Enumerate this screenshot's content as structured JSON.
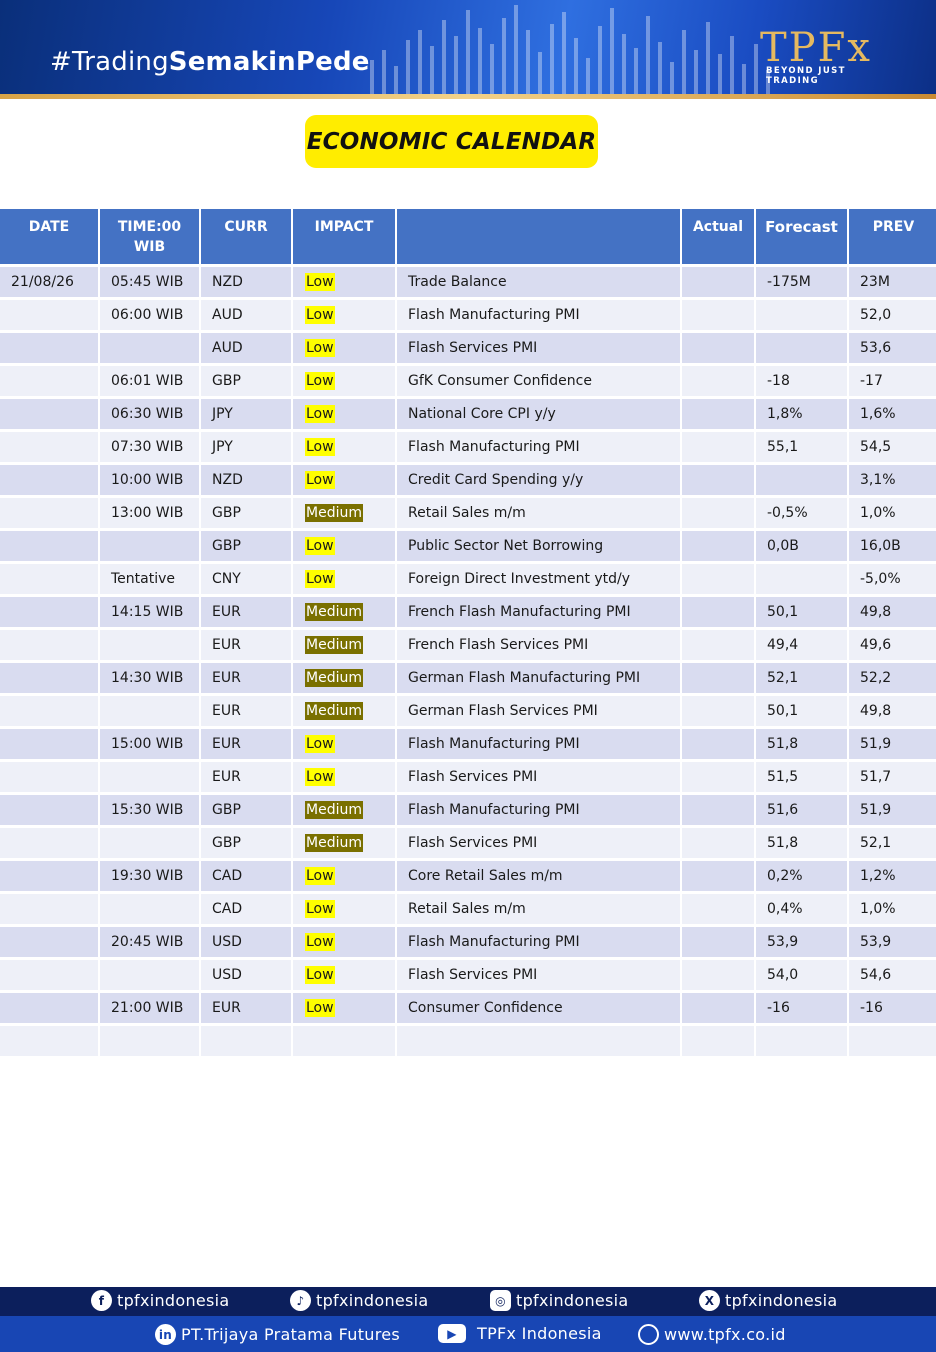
{
  "banner": {
    "hashtag_light": "#Trading",
    "hashtag_bold": "SemakinPede",
    "logo_text": "TPFx",
    "logo_tagline": "BEYOND JUST TRADING"
  },
  "title": "ECONOMIC CALENDAR",
  "table": {
    "headers": {
      "date": "DATE",
      "time_line1": "TIME:00",
      "time_line2": "WIB",
      "curr": "CURR",
      "impact": "IMPACT",
      "event": "",
      "actual": "Actual",
      "forecast": "Forecast",
      "prev": "PREV"
    },
    "rows": [
      {
        "date": "21/08/26",
        "time": "05:45 WIB",
        "curr": "NZD",
        "impact": "Low",
        "event": "Trade Balance",
        "actual": "",
        "forecast": "-175M",
        "prev": "23M"
      },
      {
        "date": "",
        "time": "06:00 WIB",
        "curr": "AUD",
        "impact": "Low",
        "event": "Flash Manufacturing PMI",
        "actual": "",
        "forecast": "",
        "prev": "52,0"
      },
      {
        "date": "",
        "time": "",
        "curr": "AUD",
        "impact": "Low",
        "event": "Flash Services PMI",
        "actual": "",
        "forecast": "",
        "prev": "53,6"
      },
      {
        "date": "",
        "time": "06:01 WIB",
        "curr": "GBP",
        "impact": "Low",
        "event": "GfK Consumer Confidence",
        "actual": "",
        "forecast": "-18",
        "prev": "-17"
      },
      {
        "date": "",
        "time": "06:30 WIB",
        "curr": "JPY",
        "impact": "Low",
        "event": "National Core CPI y/y",
        "actual": "",
        "forecast": "1,8%",
        "prev": "1,6%"
      },
      {
        "date": "",
        "time": "07:30 WIB",
        "curr": "JPY",
        "impact": "Low",
        "event": "Flash Manufacturing PMI",
        "actual": "",
        "forecast": "55,1",
        "prev": "54,5"
      },
      {
        "date": "",
        "time": "10:00 WIB",
        "curr": "NZD",
        "impact": "Low",
        "event": "Credit Card Spending y/y",
        "actual": "",
        "forecast": "",
        "prev": "3,1%"
      },
      {
        "date": "",
        "time": "13:00 WIB",
        "curr": "GBP",
        "impact": "Medium",
        "event": "Retail Sales m/m",
        "actual": "",
        "forecast": "-0,5%",
        "prev": "1,0%"
      },
      {
        "date": "",
        "time": "",
        "curr": "GBP",
        "impact": "Low",
        "event": "Public Sector Net Borrowing",
        "actual": "",
        "forecast": "0,0B",
        "prev": "16,0B"
      },
      {
        "date": "",
        "time": "Tentative",
        "curr": "CNY",
        "impact": "Low",
        "event": "Foreign Direct Investment ytd/y",
        "actual": "",
        "forecast": "",
        "prev": "-5,0%"
      },
      {
        "date": "",
        "time": "14:15 WIB",
        "curr": "EUR",
        "impact": "Medium",
        "event": "French Flash Manufacturing PMI",
        "actual": "",
        "forecast": "50,1",
        "prev": "49,8"
      },
      {
        "date": "",
        "time": "",
        "curr": "EUR",
        "impact": "Medium",
        "event": "French Flash Services PMI",
        "actual": "",
        "forecast": "49,4",
        "prev": "49,6"
      },
      {
        "date": "",
        "time": "14:30 WIB",
        "curr": "EUR",
        "impact": "Medium",
        "event": "German Flash Manufacturing PMI",
        "actual": "",
        "forecast": "52,1",
        "prev": "52,2"
      },
      {
        "date": "",
        "time": "",
        "curr": "EUR",
        "impact": "Medium",
        "event": "German Flash Services PMI",
        "actual": "",
        "forecast": "50,1",
        "prev": "49,8"
      },
      {
        "date": "",
        "time": "15:00 WIB",
        "curr": "EUR",
        "impact": "Low",
        "event": "Flash Manufacturing PMI",
        "actual": "",
        "forecast": "51,8",
        "prev": "51,9"
      },
      {
        "date": "",
        "time": "",
        "curr": "EUR",
        "impact": "Low",
        "event": "Flash Services PMI",
        "actual": "",
        "forecast": "51,5",
        "prev": "51,7"
      },
      {
        "date": "",
        "time": "15:30 WIB",
        "curr": "GBP",
        "impact": "Medium",
        "event": "Flash Manufacturing PMI",
        "actual": "",
        "forecast": "51,6",
        "prev": "51,9"
      },
      {
        "date": "",
        "time": "",
        "curr": "GBP",
        "impact": "Medium",
        "event": "Flash Services PMI",
        "actual": "",
        "forecast": "51,8",
        "prev": "52,1"
      },
      {
        "date": "",
        "time": "19:30 WIB",
        "curr": "CAD",
        "impact": "Low",
        "event": "Core Retail Sales m/m",
        "actual": "",
        "forecast": "0,2%",
        "prev": "1,2%"
      },
      {
        "date": "",
        "time": "",
        "curr": "CAD",
        "impact": "Low",
        "event": "Retail Sales m/m",
        "actual": "",
        "forecast": "0,4%",
        "prev": "1,0%"
      },
      {
        "date": "",
        "time": "20:45 WIB",
        "curr": "USD",
        "impact": "Low",
        "event": "Flash Manufacturing PMI",
        "actual": "",
        "forecast": "53,9",
        "prev": "53,9"
      },
      {
        "date": "",
        "time": "",
        "curr": "USD",
        "impact": "Low",
        "event": "Flash Services PMI",
        "actual": "",
        "forecast": "54,0",
        "prev": "54,6"
      },
      {
        "date": "",
        "time": "21:00 WIB",
        "curr": "EUR",
        "impact": "Low",
        "event": "Consumer Confidence",
        "actual": "",
        "forecast": "-16",
        "prev": "-16"
      },
      {
        "date": "",
        "time": "",
        "curr": "",
        "impact": "",
        "event": "",
        "actual": "",
        "forecast": "",
        "prev": ""
      }
    ]
  },
  "colors": {
    "header_bg": "#4472c4",
    "row_odd": "#d9dcf0",
    "row_even": "#eef0f8",
    "low_badge": "#ffff00",
    "medium_badge": "#7a7000",
    "title_badge": "#ffed00"
  },
  "footer": {
    "social": [
      {
        "icon": "facebook-icon",
        "label": "tpfxindonesia"
      },
      {
        "icon": "tiktok-icon",
        "label": "tpfxindonesia"
      },
      {
        "icon": "instagram-icon",
        "label": "tpfxindonesia"
      },
      {
        "icon": "x-icon",
        "label": "tpfxindonesia"
      }
    ],
    "links": [
      {
        "icon": "linkedin-icon",
        "label": "PT.Trijaya Pratama Futures"
      },
      {
        "icon": "youtube-icon",
        "label": "TPFx Indonesia"
      },
      {
        "icon": "globe-icon",
        "label": "www.tpfx.co.id"
      }
    ]
  }
}
